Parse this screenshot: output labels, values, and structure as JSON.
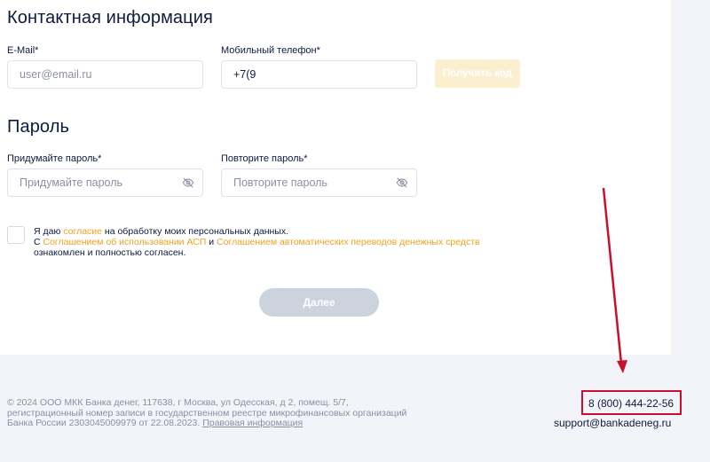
{
  "contact": {
    "title": "Контактная информация",
    "email_label": "E-Mail*",
    "email_placeholder": "user@email.ru",
    "phone_label": "Мобильный телефон*",
    "phone_value": "+7(9",
    "get_code_label": "Получить код"
  },
  "password": {
    "title": "Пароль",
    "create_label": "Придумайте пароль*",
    "create_placeholder": "Придумайте пароль",
    "repeat_label": "Повторите пароль*",
    "repeat_placeholder": "Повторите пароль"
  },
  "consent": {
    "part1": "Я даю ",
    "link1": "согласие",
    "part2": " на обработку моих персональных данных.",
    "part3": "С ",
    "link2": "Соглашением об использовании АСП",
    "part4": " и ",
    "link3": "Соглашением автоматических переводов денежных средств",
    "part5": "ознакомлен и полностью согласен."
  },
  "next_label": "Далее",
  "footer": {
    "line1": "© 2024 ООО МКК Банка денег, 117638, г Москва, ул Одесская, д 2, помещ. 5/7,",
    "line2": "регистрационный номер записи в государственном реестре микрофинансовых организаций",
    "line3": "Банка России 2303045009979 от 22.08.2023. ",
    "legal_link": "Правовая информация",
    "phone": "8 (800) 444-22-56",
    "email": "support@bankadeneg.ru"
  },
  "colors": {
    "accent": "#f0a21f",
    "annotation": "#c8102e",
    "disabled_button": "#cdd3dd"
  }
}
